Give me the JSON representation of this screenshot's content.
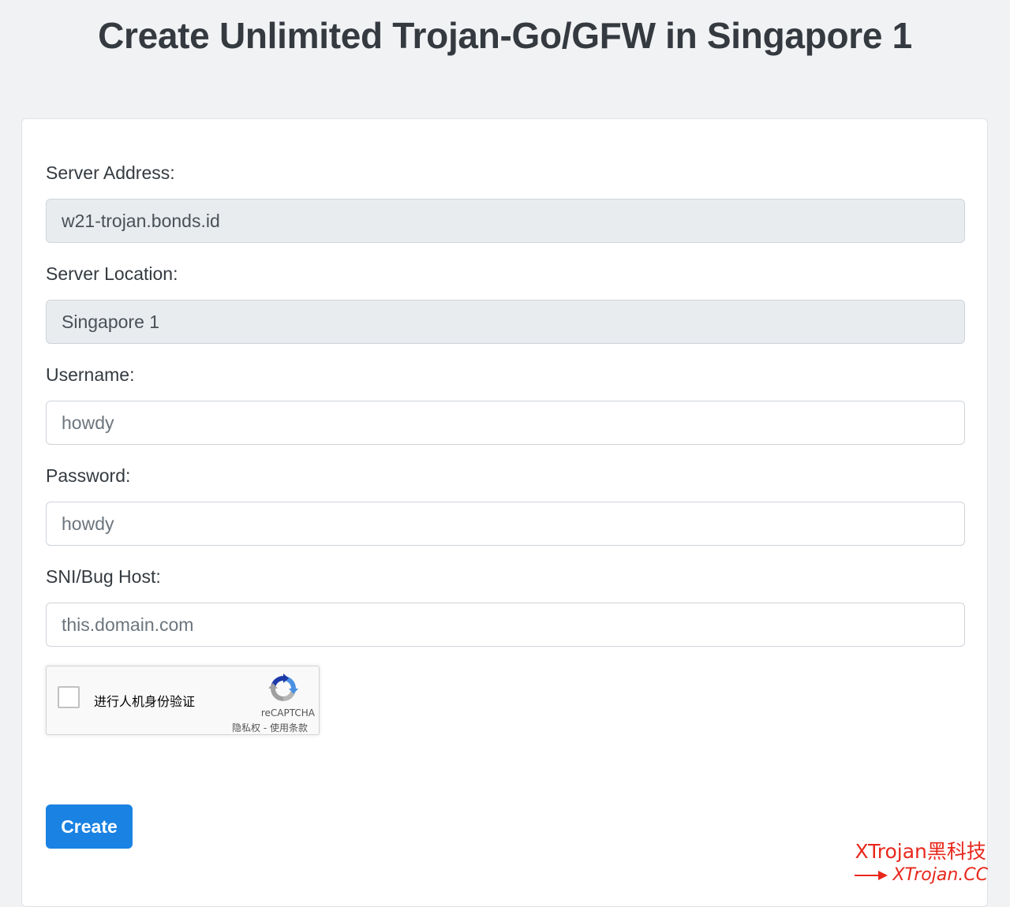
{
  "page": {
    "title": "Create Unlimited Trojan-Go/GFW in Singapore 1"
  },
  "form": {
    "server_address": {
      "label": "Server Address:",
      "value": "w21-trojan.bonds.id"
    },
    "server_location": {
      "label": "Server Location:",
      "value": "Singapore 1"
    },
    "username": {
      "label": "Username:",
      "placeholder": "howdy"
    },
    "password": {
      "label": "Password:",
      "placeholder": "howdy"
    },
    "sni": {
      "label": "SNI/Bug Host:",
      "placeholder": "this.domain.com"
    },
    "recaptcha": {
      "label": "进行人机身份验证",
      "brand": "reCAPTCHA",
      "privacy": "隐私权",
      "separator": " - ",
      "terms": "使用条款"
    },
    "submit_label": "Create"
  },
  "watermark": {
    "line1": "XTrojan黑科技",
    "line2": "XTrojan.CC"
  },
  "colors": {
    "primary": "#1a82e2",
    "background": "#f1f2f4",
    "readonly_field": "#e9ecef",
    "watermark": "#e8271b"
  }
}
